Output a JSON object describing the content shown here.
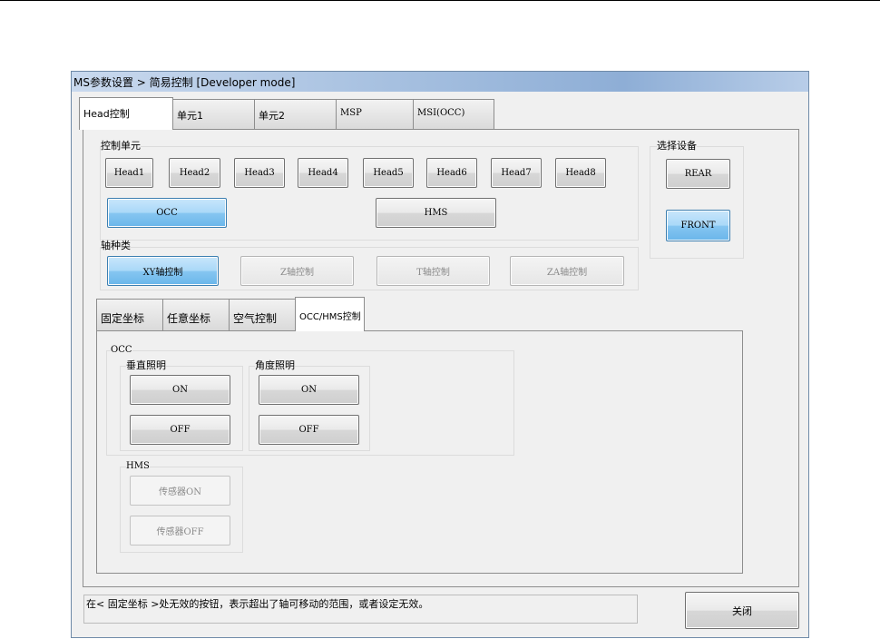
{
  "window": {
    "title": "MS参数设置 > 简易控制 [Developer mode]"
  },
  "main_tabs": [
    {
      "label": "Head控制"
    },
    {
      "label": "单元1"
    },
    {
      "label": "单元2"
    },
    {
      "label": "MSP"
    },
    {
      "label": "MSI(OCC)"
    }
  ],
  "control_unit": {
    "label": "控制单元",
    "heads": [
      "Head1",
      "Head2",
      "Head3",
      "Head4",
      "Head5",
      "Head6",
      "Head7",
      "Head8"
    ],
    "occ": "OCC",
    "hms": "HMS"
  },
  "device": {
    "label": "选择设备",
    "rear": "REAR",
    "front": "FRONT"
  },
  "axis": {
    "label": "轴种类",
    "xy": "XY轴控制",
    "z": "Z轴控制",
    "t": "T轴控制",
    "za": "ZA轴控制"
  },
  "sub_tabs": [
    {
      "label": "固定坐标"
    },
    {
      "label": "任意坐标"
    },
    {
      "label": "空气控制"
    },
    {
      "label": "OCC/HMS控制"
    }
  ],
  "occ_group": {
    "label": "OCC",
    "vertical": {
      "label": "垂直照明",
      "on": "ON",
      "off": "OFF"
    },
    "angle": {
      "label": "角度照明",
      "on": "ON",
      "off": "OFF"
    }
  },
  "hms_group": {
    "label": "HMS",
    "sensor_on": "传感器ON",
    "sensor_off": "传感器OFF"
  },
  "status_message": "在< 固定坐标 >处无效的按钮，表示超出了轴可移动的范围，或者设定无效。",
  "close_button": "关闭"
}
